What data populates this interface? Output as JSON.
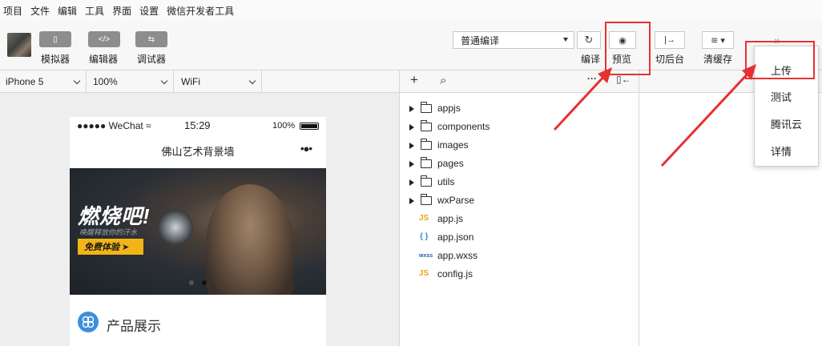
{
  "menubar": {
    "items": [
      "项目",
      "文件",
      "编辑",
      "工具",
      "界面",
      "设置",
      "微信开发者工具"
    ]
  },
  "toolbar": {
    "simulator_label": "模拟器",
    "simulator_glyph": "▯",
    "editor_label": "编辑器",
    "editor_glyph": "</>",
    "debugger_label": "调试器",
    "debugger_glyph": "⇆",
    "compile_mode": "普通编译",
    "refresh_glyph": "↻",
    "preview_glyph": "◉",
    "background_glyph": "|→",
    "cache_glyph": "≋ ▾",
    "more_glyph": "»",
    "compile_label": "编译",
    "preview_label": "预览",
    "background_label": "切后台",
    "clear_cache_label": "清缓存"
  },
  "secbar": {
    "device": "iPhone 5",
    "zoom": "100%",
    "network": "WiFi",
    "add_glyph": "+",
    "search_glyph": "⌕",
    "more_glyph": "···",
    "layout_glyph": "▯←"
  },
  "phone": {
    "carrier": "●●●●● WeChat ≈",
    "time": "15:29",
    "battery": "100%",
    "nav_title": "佛山艺术背景墙",
    "nav_dots": "•●•",
    "banner_slogan": "燃烧吧!",
    "banner_subslogan": "唤醒释放你的汗水",
    "banner_cta": "免费体验 ➤",
    "section_title": "产品展示"
  },
  "filetree": {
    "items": [
      {
        "name": "appjs",
        "type": "folder"
      },
      {
        "name": "components",
        "type": "folder"
      },
      {
        "name": "images",
        "type": "folder"
      },
      {
        "name": "pages",
        "type": "folder"
      },
      {
        "name": "utils",
        "type": "folder"
      },
      {
        "name": "wxParse",
        "type": "folder"
      },
      {
        "name": "app.js",
        "type": "js",
        "badge": "JS"
      },
      {
        "name": "app.json",
        "type": "json",
        "badge": "{ }"
      },
      {
        "name": "app.wxss",
        "type": "wxss",
        "badge": "wxss"
      },
      {
        "name": "config.js",
        "type": "js",
        "badge": "JS"
      }
    ]
  },
  "dropdown": {
    "items": [
      "上传",
      "测试",
      "腾讯云",
      "详情"
    ]
  },
  "colors": {
    "highlight": "#e83030",
    "js_badge": "#e8a416",
    "json_badge": "#2f8ad8",
    "wxss_badge": "#2a5aa8",
    "section_icon": "#3d8fdd",
    "cta": "#f2b417"
  }
}
